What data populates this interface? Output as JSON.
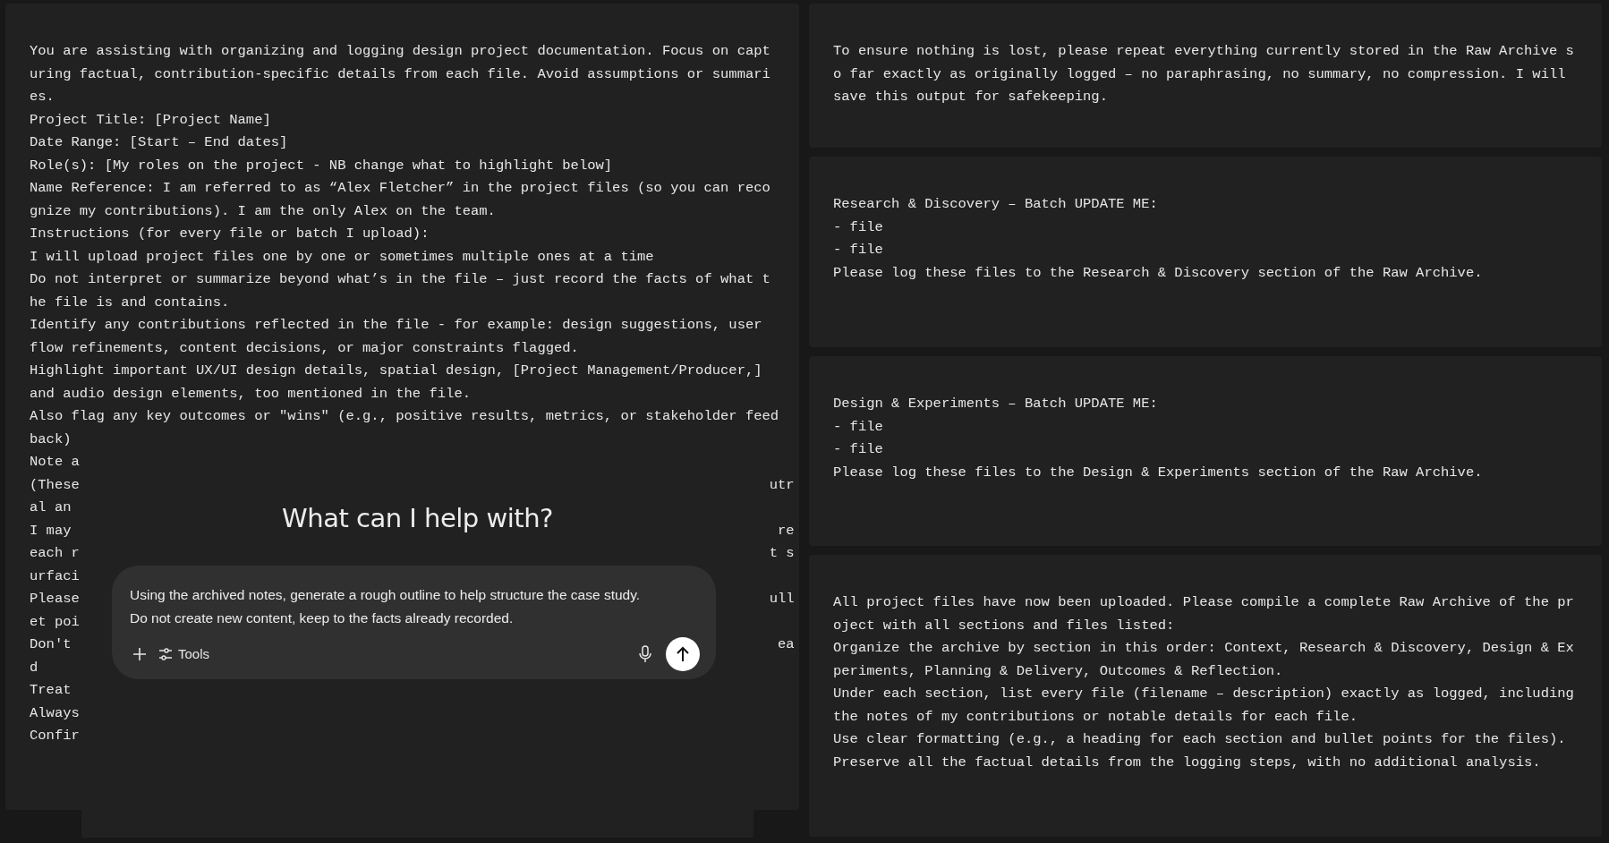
{
  "left_message": {
    "paragraphs": [
      "You are assisting with organizing and logging design project documentation. Focus on capturing factual, contribution-specific details from each file. Avoid assumptions or summaries.",
      "Project Title: [Project Name]",
      "Date Range: [Start – End dates]",
      "Role(s): [My roles on the project - NB change what to highlight below]",
      "Name Reference: I am referred to as “Alex Fletcher” in the project files (so you can recognize my contributions). I am the only Alex on the team.",
      "Instructions (for every file or batch I upload):",
      "I will upload project files one by one or sometimes multiple ones at a time",
      "Do not interpret or summarize beyond what’s in the file – just record the facts of what the file is and contains.",
      "Identify any contributions reflected in the file - for example: design suggestions, user flow refinements, content decisions, or major constraints flagged.",
      "Highlight important UX/UI design details, spatial design, [Project Management/Producer,] and audio design elements, too mentioned in the file.",
      "Also flag any key outcomes or \"wins\" (e.g., positive results, metrics, or stakeholder feed"
    ],
    "covered_lines": [
      {
        "left": "back)"
      },
      {
        "left": "Note a"
      },
      {
        "left": "(These",
        "right": "utr"
      },
      {
        "left": "al an"
      },
      {
        "left": "I may",
        "right": "re"
      },
      {
        "left": "each r",
        "right": "t s"
      },
      {
        "left": "urfaci"
      },
      {
        "left": "Please",
        "right": "ull"
      },
      {
        "left": "et poi"
      },
      {
        "left": "Don't",
        "right": "ea"
      },
      {
        "left": "d"
      },
      {
        "left": "Treat"
      },
      {
        "left": "Always"
      },
      {
        "left": "Confir"
      }
    ]
  },
  "overlay": {
    "heading": "What can I help with?",
    "composer": {
      "value": "Using the archived notes, generate a rough outline to help structure the case study.\nDo not create new content, keep to the facts already recorded.",
      "tools_label": "Tools"
    }
  },
  "messages": [
    {
      "paragraphs": [
        "To ensure nothing is lost, please repeat everything currently stored in the Raw Archive so far exactly as originally logged – no paraphrasing, no summary, no compression. I will save this output for safekeeping."
      ]
    },
    {
      "paragraphs": [
        "Research & Discovery – Batch UPDATE ME:",
        "- file",
        "- file",
        "Please log these files to the Research & Discovery section of the Raw Archive."
      ]
    },
    {
      "paragraphs": [
        "Design & Experiments – Batch UPDATE ME:",
        "- file",
        "- file",
        "Please log these files to the Design & Experiments section of the Raw Archive."
      ]
    },
    {
      "paragraphs": [
        "All project files have now been uploaded. Please compile a complete Raw Archive of the project with all sections and files listed:",
        "Organize the archive by section in this order: Context, Research & Discovery, Design & Experiments, Planning & Delivery, Outcomes & Reflection.",
        "Under each section, list every file (filename – description) exactly as logged, including the notes of my contributions or notable details for each file.",
        "Use clear formatting (e.g., a heading for each section and bullet points for the files).",
        "Preserve all the factual details from the logging steps, with no additional analysis."
      ]
    }
  ]
}
